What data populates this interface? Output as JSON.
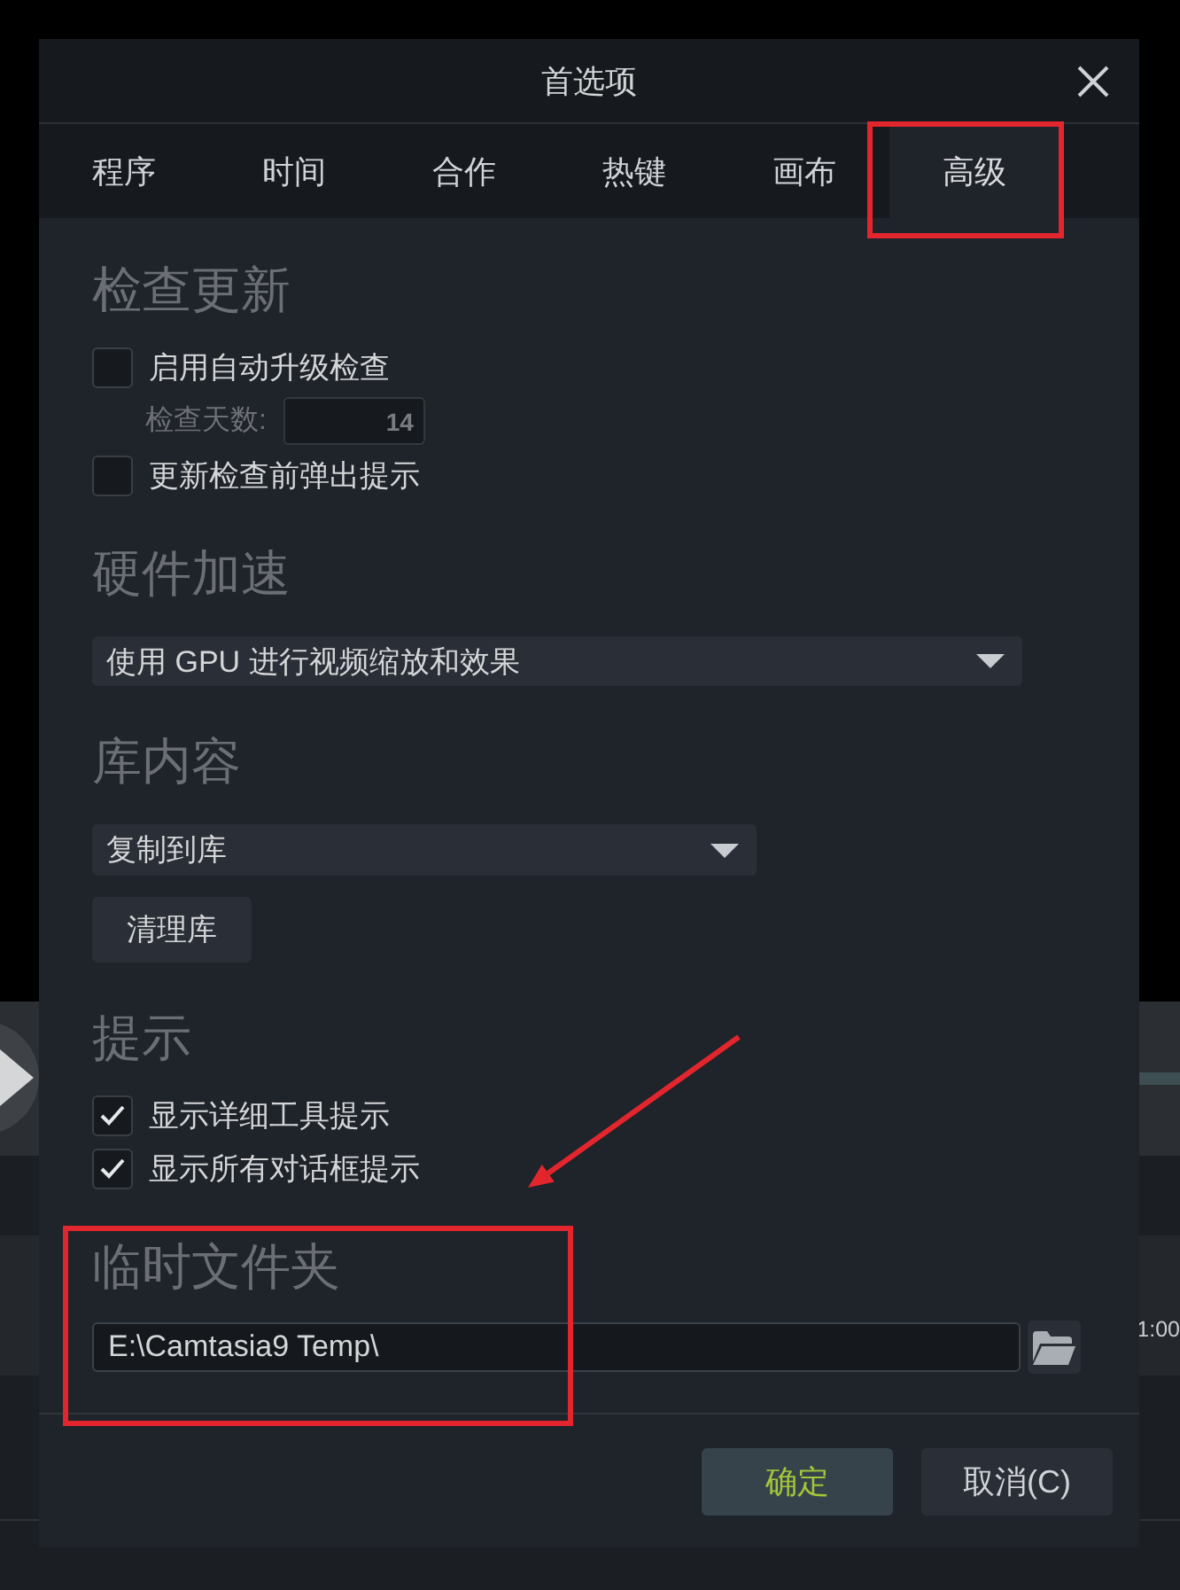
{
  "window": {
    "title": "首选项"
  },
  "tabs": [
    {
      "label": "程序",
      "selected": false
    },
    {
      "label": "时间",
      "selected": false
    },
    {
      "label": "合作",
      "selected": false
    },
    {
      "label": "热键",
      "selected": false
    },
    {
      "label": "画布",
      "selected": false
    },
    {
      "label": "高级",
      "selected": true
    }
  ],
  "check_updates": {
    "heading": "检查更新",
    "auto_check": {
      "label": "启用自动升级检查",
      "checked": false
    },
    "interval": {
      "label": "检查天数:",
      "value": "14",
      "disabled": true
    },
    "notify": {
      "label": "更新检查前弹出提示",
      "checked": false
    }
  },
  "hardware_acceleration": {
    "heading": "硬件加速",
    "dropdown": {
      "value": "使用 GPU 进行视频缩放和效果"
    }
  },
  "library_content": {
    "heading": "库内容",
    "dropdown": {
      "value": "复制到库"
    },
    "button": "清理库"
  },
  "tips": {
    "heading": "提示",
    "options": [
      {
        "label": "显示详细工具提示",
        "checked": true
      },
      {
        "label": "显示所有对话框提示",
        "checked": true
      }
    ]
  },
  "temp_folder": {
    "heading": "临时文件夹",
    "path": "E:\\Camtasia9 Temp\\"
  },
  "buttons": [
    {
      "label": "确定",
      "kind": "primary"
    },
    {
      "label": "取消(C)",
      "kind": "secondary"
    }
  ],
  "background_editor": {
    "time_label": "1:00"
  },
  "annotations": [
    {
      "kind": "frame"
    },
    {
      "kind": "arrow"
    },
    {
      "kind": "frame"
    }
  ]
}
